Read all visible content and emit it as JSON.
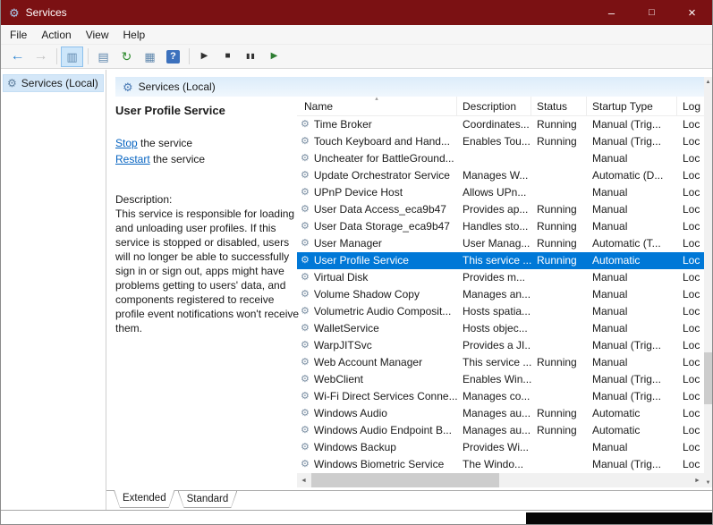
{
  "colors": {
    "titlebar": "#7b1113",
    "selection": "#0078d7",
    "link": "#0563c1",
    "header_gradient_top": "#dcecfa"
  },
  "icons": {
    "gear": "⚙"
  },
  "window": {
    "title": "Services",
    "minimize": "–",
    "maximize": "□",
    "close": "×"
  },
  "menu": {
    "items": [
      "File",
      "Action",
      "View",
      "Help"
    ]
  },
  "toolbar": {
    "buttons": [
      {
        "name": "back-button",
        "glyph": "←",
        "cls": "nav"
      },
      {
        "name": "forward-button",
        "glyph": "→",
        "cls": "nav disabled"
      },
      {
        "name": "separator"
      },
      {
        "name": "show-hide-console-tree-button",
        "glyph": "▥",
        "cls": "ico pressed"
      },
      {
        "name": "separator"
      },
      {
        "name": "properties-button",
        "glyph": "▤",
        "cls": "ico"
      },
      {
        "name": "refresh-button",
        "glyph": "↻",
        "cls": "ico refresh"
      },
      {
        "name": "export-list-button",
        "glyph": "▦",
        "cls": "ico"
      },
      {
        "name": "help-button",
        "glyph": "?",
        "cls": "ico help"
      },
      {
        "name": "separator"
      },
      {
        "name": "start-service-button",
        "glyph": "▶",
        "cls": "media"
      },
      {
        "name": "stop-service-button",
        "glyph": "■",
        "cls": "media"
      },
      {
        "name": "pause-service-button",
        "glyph": "▮▮",
        "cls": "media pause"
      },
      {
        "name": "restart-service-button",
        "glyph": "▶",
        "cls": "media restart"
      }
    ]
  },
  "tree": {
    "root_label": "Services (Local)"
  },
  "panel": {
    "header": {
      "title": "Services (Local)"
    },
    "extended": {
      "title": "User Profile Service",
      "stop_link": "Stop",
      "stop_suffix": " the service",
      "restart_link": "Restart",
      "restart_suffix": " the service",
      "description_label": "Description:",
      "description": "This service is responsible for loading and unloading user profiles. If this service is stopped or disabled, users will no longer be able to successfully sign in or sign out, apps might have problems getting to users' data, and components registered to receive profile event notifications won't receive them."
    },
    "table": {
      "columns": [
        "Name",
        "Description",
        "Status",
        "Startup Type",
        "Log"
      ],
      "sort_icon": "▴",
      "row_icon": "⚙",
      "rows": [
        {
          "name": "Time Broker",
          "description": "Coordinates...",
          "status": "Running",
          "startup_type": "Manual (Trig...",
          "log_on_as": "Loc",
          "selected": false
        },
        {
          "name": "Touch Keyboard and Hand...",
          "description": "Enables Tou...",
          "status": "Running",
          "startup_type": "Manual (Trig...",
          "log_on_as": "Loc",
          "selected": false
        },
        {
          "name": "Uncheater for BattleGround...",
          "description": "",
          "status": "",
          "startup_type": "Manual",
          "log_on_as": "Loc",
          "selected": false
        },
        {
          "name": "Update Orchestrator Service",
          "description": "Manages W...",
          "status": "",
          "startup_type": "Automatic (D...",
          "log_on_as": "Loc",
          "selected": false
        },
        {
          "name": "UPnP Device Host",
          "description": "Allows UPn...",
          "status": "",
          "startup_type": "Manual",
          "log_on_as": "Loc",
          "selected": false
        },
        {
          "name": "User Data Access_eca9b47",
          "description": "Provides ap...",
          "status": "Running",
          "startup_type": "Manual",
          "log_on_as": "Loc",
          "selected": false
        },
        {
          "name": "User Data Storage_eca9b47",
          "description": "Handles sto...",
          "status": "Running",
          "startup_type": "Manual",
          "log_on_as": "Loc",
          "selected": false
        },
        {
          "name": "User Manager",
          "description": "User Manag...",
          "status": "Running",
          "startup_type": "Automatic (T...",
          "log_on_as": "Loc",
          "selected": false
        },
        {
          "name": "User Profile Service",
          "description": "This service ...",
          "status": "Running",
          "startup_type": "Automatic",
          "log_on_as": "Loc",
          "selected": true
        },
        {
          "name": "Virtual Disk",
          "description": "Provides m...",
          "status": "",
          "startup_type": "Manual",
          "log_on_as": "Loc",
          "selected": false
        },
        {
          "name": "Volume Shadow Copy",
          "description": "Manages an...",
          "status": "",
          "startup_type": "Manual",
          "log_on_as": "Loc",
          "selected": false
        },
        {
          "name": "Volumetric Audio Composit...",
          "description": "Hosts spatia...",
          "status": "",
          "startup_type": "Manual",
          "log_on_as": "Loc",
          "selected": false
        },
        {
          "name": "WalletService",
          "description": "Hosts objec...",
          "status": "",
          "startup_type": "Manual",
          "log_on_as": "Loc",
          "selected": false
        },
        {
          "name": "WarpJITSvc",
          "description": "Provides a JI...",
          "status": "",
          "startup_type": "Manual (Trig...",
          "log_on_as": "Loc",
          "selected": false
        },
        {
          "name": "Web Account Manager",
          "description": "This service ...",
          "status": "Running",
          "startup_type": "Manual",
          "log_on_as": "Loc",
          "selected": false
        },
        {
          "name": "WebClient",
          "description": "Enables Win...",
          "status": "",
          "startup_type": "Manual (Trig...",
          "log_on_as": "Loc",
          "selected": false
        },
        {
          "name": "Wi-Fi Direct Services Conne...",
          "description": "Manages co...",
          "status": "",
          "startup_type": "Manual (Trig...",
          "log_on_as": "Loc",
          "selected": false
        },
        {
          "name": "Windows Audio",
          "description": "Manages au...",
          "status": "Running",
          "startup_type": "Automatic",
          "log_on_as": "Loc",
          "selected": false
        },
        {
          "name": "Windows Audio Endpoint B...",
          "description": "Manages au...",
          "status": "Running",
          "startup_type": "Automatic",
          "log_on_as": "Loc",
          "selected": false
        },
        {
          "name": "Windows Backup",
          "description": "Provides Wi...",
          "status": "",
          "startup_type": "Manual",
          "log_on_as": "Loc",
          "selected": false
        },
        {
          "name": "Windows Biometric Service",
          "description": "The Windo...",
          "status": "",
          "startup_type": "Manual (Trig...",
          "log_on_as": "Loc",
          "selected": false
        }
      ]
    },
    "tabs": [
      {
        "label": "Extended",
        "active": true
      },
      {
        "label": "Standard",
        "active": false
      }
    ]
  },
  "scrollbars": {
    "left": "◄",
    "right": "►",
    "up": "▲",
    "down": "▼"
  }
}
